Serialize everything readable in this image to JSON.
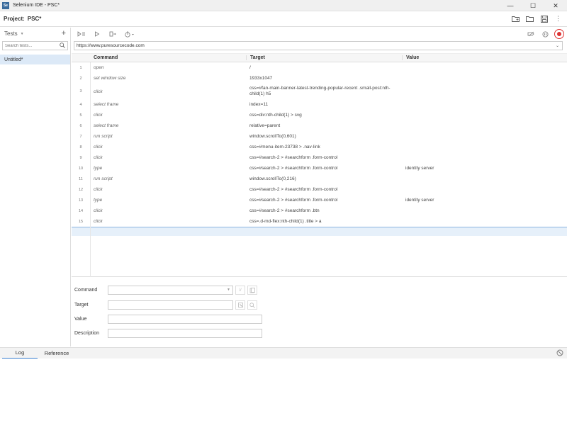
{
  "window": {
    "title": "Selenium IDE - PSC*",
    "app_icon_text": "Se"
  },
  "project": {
    "label": "Project:",
    "name": "PSC*"
  },
  "tests_panel": {
    "header": "Tests",
    "search_placeholder": "Search tests...",
    "items": [
      {
        "label": "Untitled*"
      }
    ]
  },
  "url": {
    "value": "https://www.puresourcecode.com"
  },
  "table": {
    "headers": {
      "command": "Command",
      "target": "Target",
      "value": "Value"
    },
    "rows": [
      {
        "num": "1",
        "command": "open",
        "target": "/",
        "value": ""
      },
      {
        "num": "2",
        "command": "set window size",
        "target": "1933x1047",
        "value": ""
      },
      {
        "num": "3",
        "command": "click",
        "target": "css=#fan-main-banner-latest-trending-popular-recent .small-post:nth-child(1) h5",
        "value": ""
      },
      {
        "num": "4",
        "command": "select frame",
        "target": "index=11",
        "value": ""
      },
      {
        "num": "5",
        "command": "click",
        "target": "css=div:nth-child(1) > svg",
        "value": ""
      },
      {
        "num": "6",
        "command": "select frame",
        "target": "relative=parent",
        "value": ""
      },
      {
        "num": "7",
        "command": "run script",
        "target": "window.scrollTo(0,601)",
        "value": ""
      },
      {
        "num": "8",
        "command": "click",
        "target": "css=#menu-item-23738 > .nav-link",
        "value": ""
      },
      {
        "num": "9",
        "command": "click",
        "target": "css=#search-2 > #searchform .form-control",
        "value": ""
      },
      {
        "num": "10",
        "command": "type",
        "target": "css=#search-2 > #searchform .form-control",
        "value": "identity server"
      },
      {
        "num": "11",
        "command": "run script",
        "target": "window.scrollTo(0,216)",
        "value": ""
      },
      {
        "num": "12",
        "command": "click",
        "target": "css=#search-2 > #searchform .form-control",
        "value": ""
      },
      {
        "num": "13",
        "command": "type",
        "target": "css=#search-2 > #searchform .form-control",
        "value": "identity server"
      },
      {
        "num": "14",
        "command": "click",
        "target": "css=#search-2 > #searchform .btn",
        "value": ""
      },
      {
        "num": "15",
        "command": "click",
        "target": "css=.d-md-flex:nth-child(1) .title > a",
        "value": ""
      }
    ]
  },
  "editor": {
    "command_label": "Command",
    "target_label": "Target",
    "value_label": "Value",
    "description_label": "Description"
  },
  "log": {
    "tabs": [
      {
        "label": "Log"
      },
      {
        "label": "Reference"
      }
    ]
  },
  "colors": {
    "record": "#dd3333",
    "selection": "#dce9f7",
    "active_tab": "#3a7fd0"
  }
}
